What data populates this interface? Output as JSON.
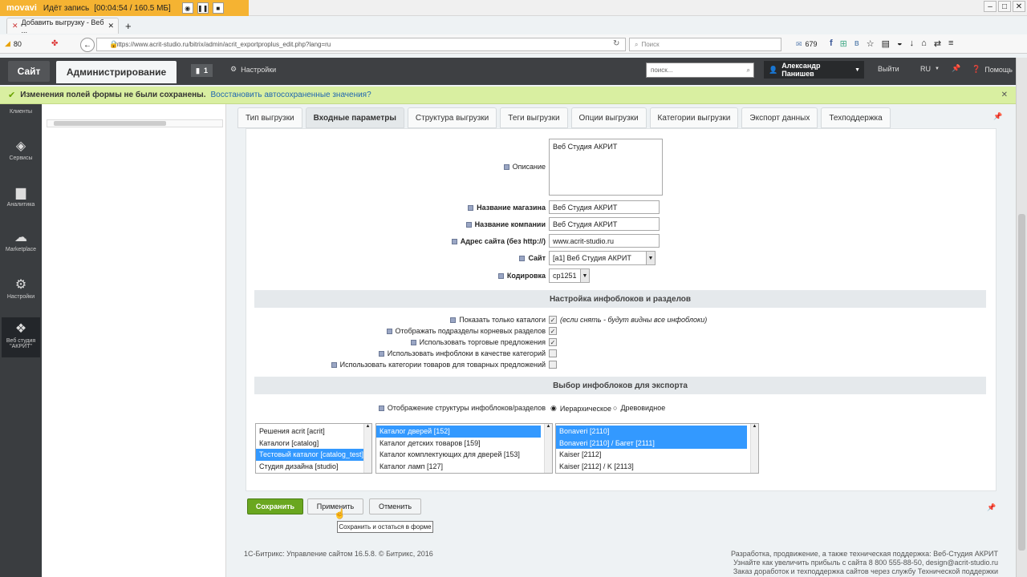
{
  "recorder": {
    "logo": "movavi",
    "status": "Идёт запись",
    "time": "[00:04:54 / 160.5 МБ]"
  },
  "browser": {
    "tab_title": "Добавить выгрузку - Веб ...",
    "new_tab": "+",
    "zoom": "80",
    "url": "https://www.acrit-studio.ru/bitrix/admin/acrit_exportproplus_edit.php?lang=ru",
    "search_placeholder": "Поиск",
    "mail_count": "679"
  },
  "adminbar": {
    "site_label": "Сайт",
    "admin_label": "Администрирование",
    "notif_count": "1",
    "settings_label": "Настройки",
    "search_placeholder": "поиск...",
    "user_name": "Александр Панишев",
    "logout": "Выйти",
    "lang": "RU",
    "help": "Помощь"
  },
  "notification": {
    "message": "Изменения полей формы не были сохранены.",
    "restore_link": "Восстановить автосохраненные значения?"
  },
  "leftnav": [
    {
      "label": "Клиенты"
    },
    {
      "label": "Сервисы"
    },
    {
      "label": "Аналитика"
    },
    {
      "label": "Marketplace"
    },
    {
      "label": "Настройки"
    },
    {
      "label": "Веб студия \"АКРИТ\""
    }
  ],
  "tabs": [
    "Тип выгрузки",
    "Входные параметры",
    "Структура выгрузки",
    "Теги выгрузки",
    "Опции выгрузки",
    "Категории выгрузки",
    "Экспорт данных",
    "Техподдержка"
  ],
  "form": {
    "description_label": "Описание",
    "description_value": "Веб Студия АКРИТ",
    "shop_name_label": "Название магазина",
    "shop_name_value": "Веб Студия АКРИТ",
    "company_label": "Название компании",
    "company_value": "Веб Студия АКРИТ",
    "site_addr_label": "Адрес сайта (без http://)",
    "site_addr_value": "www.acrit-studio.ru",
    "site_label": "Сайт",
    "site_value": "[a1] Веб Студия АКРИТ",
    "encoding_label": "Кодировка",
    "encoding_value": "cp1251"
  },
  "section_iblocks": {
    "title": "Настройка инфоблоков и разделов",
    "options": [
      {
        "label": "Показать только каталоги",
        "checked": "✓",
        "note": "(если снять - будут видны все инфоблоки)"
      },
      {
        "label": "Отображать подразделы корневых разделов",
        "checked": "✓",
        "note": ""
      },
      {
        "label": "Использовать торговые предложения",
        "checked": "✓",
        "note": ""
      },
      {
        "label": "Использовать инфоблоки в качестве категорий",
        "checked": "",
        "note": ""
      },
      {
        "label": "Использовать категории товаров для товарных предложений",
        "checked": "",
        "note": ""
      }
    ]
  },
  "section_export": {
    "title": "Выбор инфоблоков для экспорта",
    "structure_label": "Отображение структуры инфоблоков/разделов",
    "radio_hier": "Иерархическое",
    "radio_tree": "Древовидное",
    "list1": [
      "Решения acrit [acrit]",
      "Каталоги [catalog]",
      "Тестовый каталог [catalog_test]",
      "Студия дизайна [studio]"
    ],
    "list2": [
      "Каталог дверей [152]",
      "Каталог детских товаров [159]",
      "Каталог комплектующих для дверей [153]",
      "Каталог ламп [127]"
    ],
    "list3": [
      "Bonaveri [2110]",
      "Bonaveri [2110] / Багет [2111]",
      "Kaiser [2112]",
      "Kaiser [2112] / K [2113]"
    ]
  },
  "buttons": {
    "save": "Сохранить",
    "apply": "Применить",
    "cancel": "Отменить",
    "tooltip": "Сохранить и остаться в форме"
  },
  "footer": {
    "left": "1С-Битрикс: Управление сайтом 16.5.8. © Битрикс, 2016",
    "right1": "Разработка, продвижение, а также техническая поддержка: Веб-Студия АКРИТ",
    "right2": "Узнайте как увеличить прибыль с сайта  8 800 555-88-50, design@acrit-studio.ru",
    "right3": "Заказ доработок и техподдержка сайтов через службу Технической поддержки"
  }
}
